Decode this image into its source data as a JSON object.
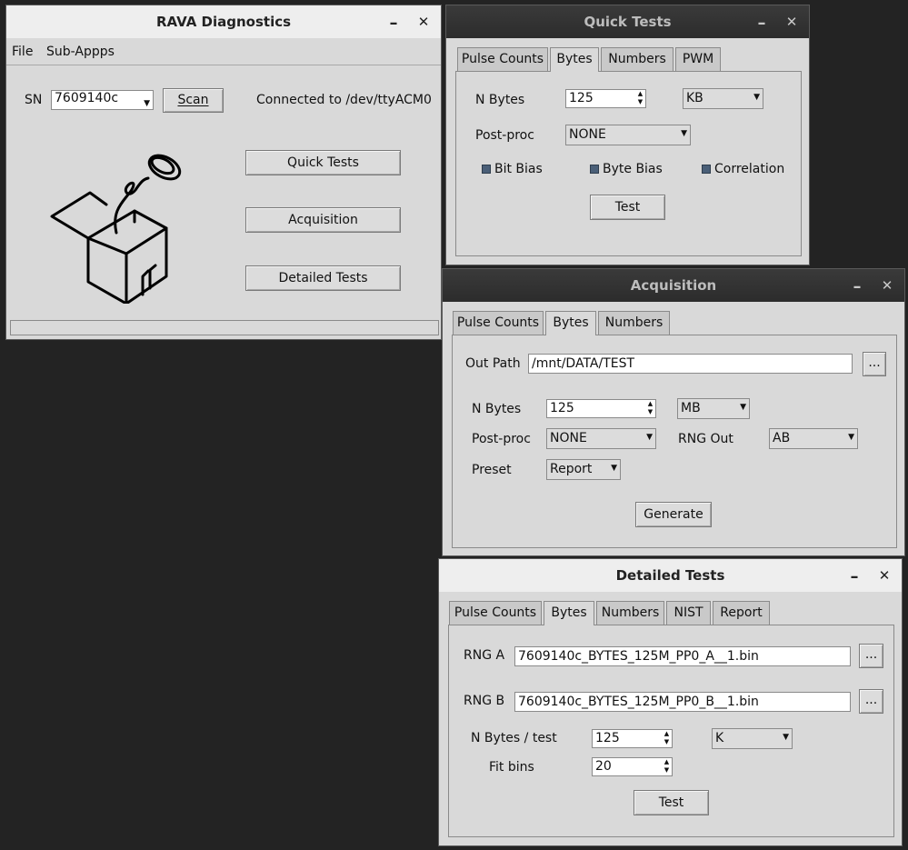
{
  "main": {
    "title": "RAVA Diagnostics",
    "controls": {
      "minimize": "–",
      "close": "✕"
    },
    "menu": {
      "file": "File",
      "subapps": "Sub-Appps"
    },
    "sn_label": "SN",
    "sn_value": "7609140c",
    "scan_button": "Scan",
    "status": "Connected to /dev/ttyACM0",
    "buttons": {
      "quick_tests": "Quick Tests",
      "acquisition": "Acquisition",
      "detailed_tests": "Detailed Tests"
    },
    "logo_icon": "jack-in-the-box-coin-icon",
    "progress": 0
  },
  "quick_tests": {
    "title": "Quick Tests",
    "controls": {
      "minimize": "–",
      "close": "✕"
    },
    "tabs": [
      "Pulse Counts",
      "Bytes",
      "Numbers",
      "PWM"
    ],
    "active_tab": "Bytes",
    "n_bytes_label": "N Bytes",
    "n_bytes_value": "125",
    "unit_value": "KB",
    "postproc_label": "Post-proc",
    "postproc_value": "NONE",
    "checks": [
      "Bit Bias",
      "Byte Bias",
      "Correlation"
    ],
    "test_button": "Test"
  },
  "acquisition": {
    "title": "Acquisition",
    "controls": {
      "minimize": "–",
      "close": "✕"
    },
    "tabs": [
      "Pulse Counts",
      "Bytes",
      "Numbers"
    ],
    "active_tab": "Bytes",
    "out_path_label": "Out Path",
    "out_path_value": "/mnt/DATA/TEST",
    "browse": "...",
    "n_bytes_label": "N Bytes",
    "n_bytes_value": "125",
    "unit_value": "MB",
    "postproc_label": "Post-proc",
    "postproc_value": "NONE",
    "rng_out_label": "RNG Out",
    "rng_out_value": "AB",
    "preset_label": "Preset",
    "preset_value": "Report",
    "generate_button": "Generate"
  },
  "detailed_tests": {
    "title": "Detailed Tests",
    "controls": {
      "minimize": "–",
      "close": "✕"
    },
    "tabs": [
      "Pulse Counts",
      "Bytes",
      "Numbers",
      "NIST",
      "Report"
    ],
    "active_tab": "Bytes",
    "rng_a_label": "RNG A",
    "rng_a_value": "7609140c_BYTES_125M_PP0_A__1.bin",
    "rng_b_label": "RNG B",
    "rng_b_value": "7609140c_BYTES_125M_PP0_B__1.bin",
    "browse": "...",
    "n_bytes_test_label": "N Bytes / test",
    "n_bytes_test_value": "125",
    "unit_value": "K",
    "fit_bins_label": "Fit bins",
    "fit_bins_value": "20",
    "test_button": "Test"
  }
}
